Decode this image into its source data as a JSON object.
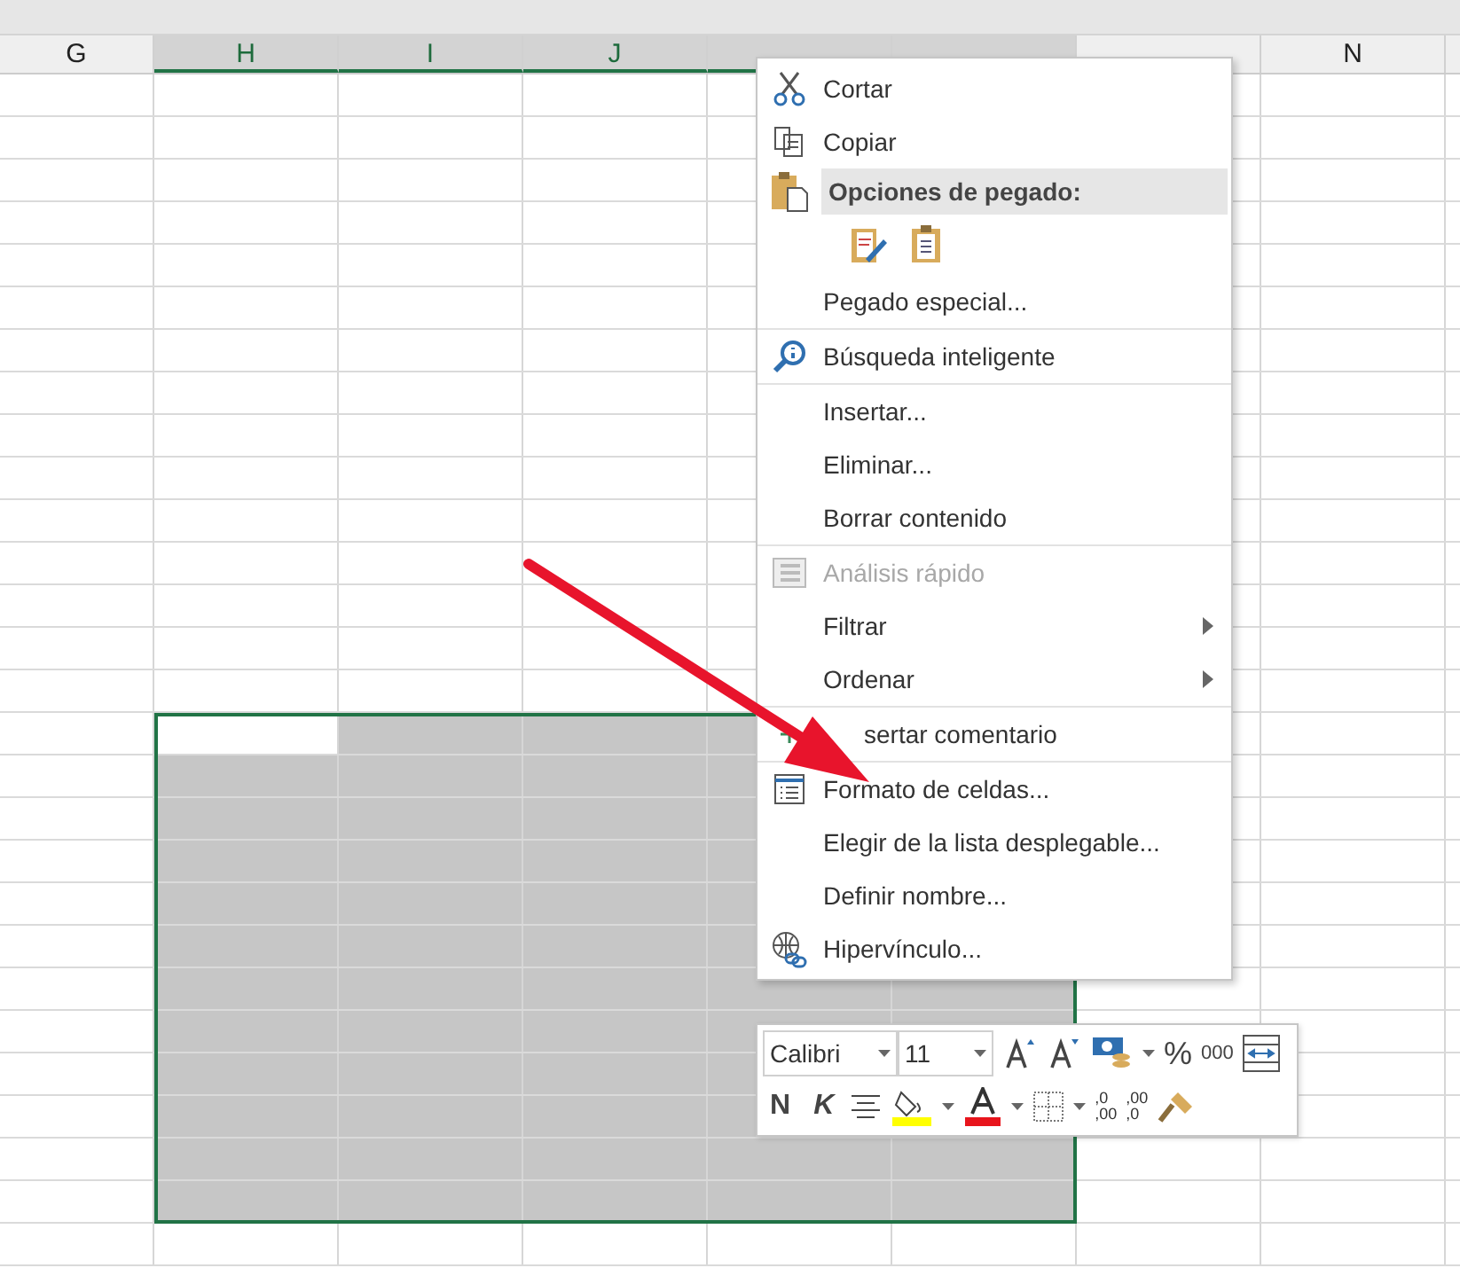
{
  "sheet": {
    "columns": [
      {
        "label": "G",
        "selected": false
      },
      {
        "label": "H",
        "selected": true
      },
      {
        "label": "I",
        "selected": true
      },
      {
        "label": "J",
        "selected": true
      },
      {
        "selected": true
      },
      {
        "selected": true
      },
      {
        "selected": false
      },
      {
        "label": "N",
        "selected": false
      }
    ],
    "rows": [
      {
        "selected": false
      },
      {
        "selected": false
      },
      {
        "selected": false
      },
      {
        "selected": false
      },
      {
        "selected": false
      },
      {
        "selected": false
      },
      {
        "selected": false
      },
      {
        "selected": false
      },
      {
        "selected": false
      },
      {
        "selected": false
      },
      {
        "selected": false
      },
      {
        "selected": false
      },
      {
        "selected": false
      },
      {
        "selected": false
      },
      {
        "selected": false
      },
      {
        "selected": true
      },
      {
        "selected": true
      },
      {
        "selected": true
      },
      {
        "selected": true
      },
      {
        "selected": true
      },
      {
        "selected": true
      },
      {
        "selected": true
      },
      {
        "selected": true
      },
      {
        "selected": true
      },
      {
        "selected": true
      },
      {
        "selected": true
      },
      {
        "selected": true
      },
      {
        "selected": false
      }
    ]
  },
  "context_menu": {
    "items": [
      {
        "kind": "item",
        "label": "Cortar",
        "disabled": false,
        "submenu": false,
        "separator_before": false
      },
      {
        "kind": "item",
        "label": "Copiar",
        "disabled": false,
        "submenu": false,
        "separator_before": false
      },
      {
        "kind": "header",
        "label": "Opciones de pegado:"
      },
      {
        "kind": "paste-options"
      },
      {
        "kind": "item",
        "label": "Pegado especial...",
        "disabled": false,
        "submenu": false,
        "separator_before": false
      },
      {
        "kind": "item",
        "label": "Búsqueda inteligente",
        "disabled": false,
        "submenu": false,
        "separator_before": true
      },
      {
        "kind": "item",
        "label": "Insertar...",
        "disabled": false,
        "submenu": false,
        "separator_before": true
      },
      {
        "kind": "item",
        "label": "Eliminar...",
        "disabled": false,
        "submenu": false,
        "separator_before": false
      },
      {
        "kind": "item",
        "label": "Borrar contenido",
        "disabled": false,
        "submenu": false,
        "separator_before": false
      },
      {
        "kind": "item",
        "label": "Análisis rápido",
        "disabled": true,
        "submenu": false,
        "separator_before": true
      },
      {
        "kind": "item",
        "label": "Filtrar",
        "disabled": false,
        "submenu": true,
        "separator_before": false
      },
      {
        "kind": "item",
        "label": "Ordenar",
        "disabled": false,
        "submenu": true,
        "separator_before": false
      },
      {
        "kind": "item",
        "label": "sertar comentario",
        "disabled": false,
        "submenu": false,
        "separator_before": true
      },
      {
        "kind": "item",
        "label": "Formato de celdas...",
        "disabled": false,
        "submenu": false,
        "separator_before": true
      },
      {
        "kind": "item",
        "label": "Elegir de la lista desplegable...",
        "disabled": false,
        "submenu": false,
        "separator_before": false
      },
      {
        "kind": "item",
        "label": "Definir nombre...",
        "disabled": false,
        "submenu": false,
        "separator_before": false
      },
      {
        "kind": "item",
        "label": "Hipervínculo...",
        "disabled": false,
        "submenu": false,
        "separator_before": false
      }
    ]
  },
  "mini_toolbar": {
    "font": "Calibri",
    "size": "11",
    "bold": "N",
    "italic": "K",
    "percent": "%",
    "thousands": "000",
    "increase_decimals": [
      ",0",
      ",00"
    ],
    "decrease_decimals": [
      ",00",
      ",0"
    ]
  }
}
